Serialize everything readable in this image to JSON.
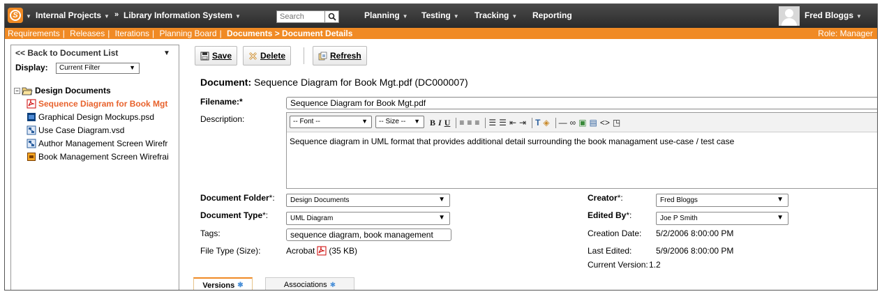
{
  "topnav": {
    "project": "Internal Projects",
    "arrow": "»",
    "product": "Library Information System",
    "search_placeholder": "Search",
    "menus": [
      "Planning",
      "Testing",
      "Tracking",
      "Reporting"
    ],
    "user": "Fred Bloggs"
  },
  "subnav": {
    "links": [
      "Requirements",
      "Releases",
      "Iterations",
      "Planning Board"
    ],
    "breadcrumb": "Documents > Document Details",
    "role": "Role: Manager"
  },
  "sidebar": {
    "back_label": "<< Back to Document List",
    "display_label": "Display:",
    "display_value": "Current Filter",
    "folder": "Design Documents",
    "items": [
      {
        "label": "Sequence Diagram for Book Mgt",
        "icon": "pdf-icon",
        "active": true
      },
      {
        "label": "Graphical Design Mockups.psd",
        "icon": "psd-icon"
      },
      {
        "label": "Use Case Diagram.vsd",
        "icon": "vsd-icon"
      },
      {
        "label": "Author Management Screen Wirefr",
        "icon": "vsd-icon"
      },
      {
        "label": "Book Management Screen Wirefrai",
        "icon": "ai-icon"
      }
    ]
  },
  "toolbar": {
    "save": "Save",
    "delete": "Delete",
    "refresh": "Refresh"
  },
  "document": {
    "title_label": "Document:",
    "title_value": "Sequence Diagram for Book Mgt.pdf (DC000007)",
    "filename_label": "Filename:*",
    "filename_value": "Sequence Diagram for Book Mgt.pdf",
    "description_label": "Description:",
    "font_select": "-- Font --",
    "size_select": "-- Size --",
    "description_value": "Sequence diagram in UML format that provides additional detail surrounding the book managament use-case / test case",
    "folder_label": "Document Folder",
    "folder_value": "Design Documents",
    "type_label": "Document Type",
    "type_value": "UML Diagram",
    "tags_label": "Tags:",
    "tags_value": "sequence diagram, book management",
    "filetype_label": "File Type (Size):",
    "filetype_value": "Acrobat",
    "filesize_value": "(35 KB)",
    "creator_label": "Creator",
    "creator_value": "Fred Bloggs",
    "editedby_label": "Edited By",
    "editedby_value": "Joe P Smith",
    "required_mark": "*:",
    "creation_label": "Creation Date:",
    "creation_value": "5/2/2006 8:00:00 PM",
    "lastedited_label": "Last Edited:",
    "lastedited_value": "5/9/2006 8:00:00 PM",
    "version_label": "Current Version:",
    "version_value": "1.2"
  },
  "tabs": [
    {
      "label": "Versions"
    },
    {
      "label": "Associations"
    }
  ],
  "colors": {
    "accent": "#f08a24",
    "nav": "#333333",
    "active_link": "#e8622c"
  }
}
